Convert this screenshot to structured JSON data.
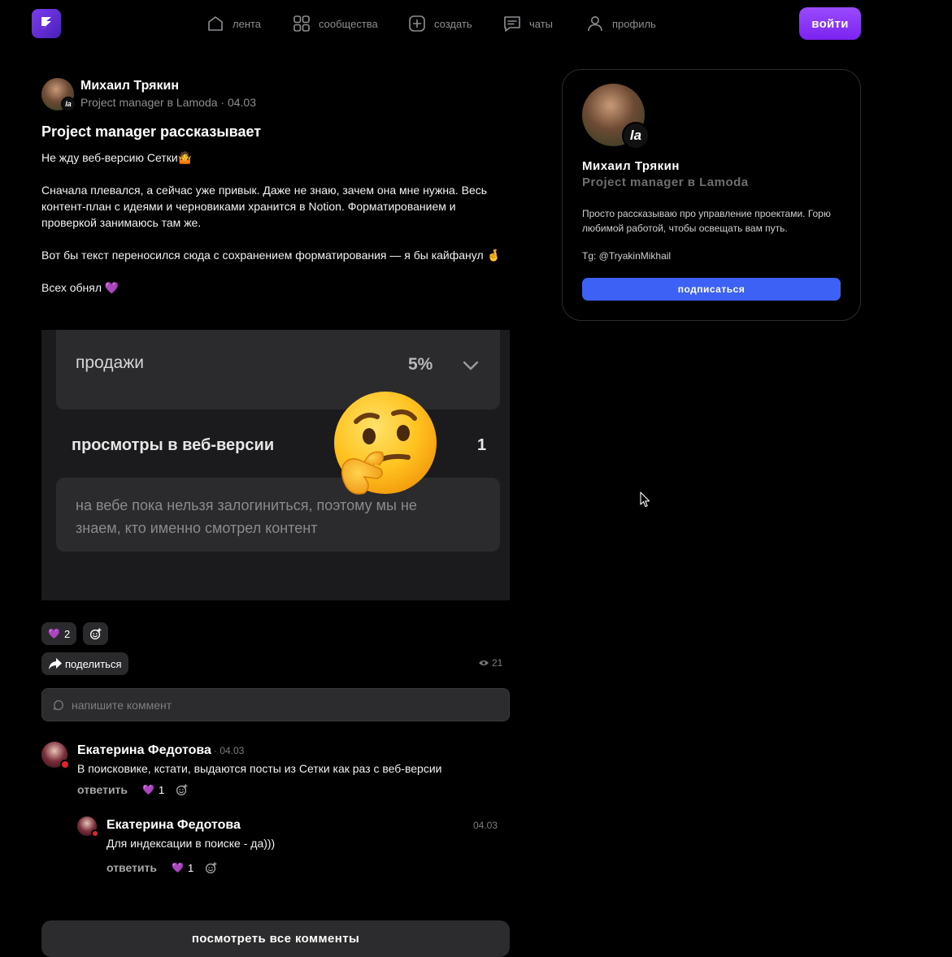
{
  "nav": {
    "items": [
      {
        "label": "лента",
        "icon": "home-icon"
      },
      {
        "label": "сообщества",
        "icon": "grid-icon"
      },
      {
        "label": "создать",
        "icon": "plus-square-icon"
      },
      {
        "label": "чаты",
        "icon": "chat-icon"
      },
      {
        "label": "профиль",
        "icon": "user-icon"
      }
    ],
    "login_label": "войти"
  },
  "post": {
    "author_name": "Михаил Трякин",
    "author_meta": "Project manager в Lamoda · 04.03",
    "avatar_badge": "la",
    "title": "Project manager рассказывает",
    "paragraphs": [
      "Не жду веб-версию Сетки🤷",
      "",
      "Сначала плевался, а сейчас уже привык. Даже не знаю, зачем она мне нужна. Весь контент-план с идеями и черновиками хранится в Notion. Форматированием и проверкой занимаюсь там же.",
      "",
      "Вот бы текст переносился сюда с сохранением форматирования — я бы кайфанул 🤞",
      "",
      "Всех обнял 💜"
    ],
    "image": {
      "sales_label": "продажи",
      "sales_pct": "5%",
      "views_label": "просмотры в веб-версии",
      "views_num": "1",
      "note": "на вебе пока нельзя залогиниться, поэтому мы не знаем, кто именно смотрел контент",
      "emoji": "thinking-face-emoji"
    },
    "reactions": {
      "heart_count": "2"
    },
    "share_label": "поделиться",
    "views": "21",
    "comment_placeholder": "напишите коммент"
  },
  "comments": [
    {
      "name": "Екатерина Федотова",
      "date": "· 04.03",
      "text": "В поисковике, кстати, выдаются посты из Сетки как раз с веб-версии",
      "reply_label": "ответить",
      "likes": "1"
    },
    {
      "name": "Екатерина Федотова",
      "date": "04.03",
      "text": "Для индексации в поиске - да)))",
      "reply_label": "ответить",
      "likes": "1"
    }
  ],
  "all_comments_label": "посмотреть все комменты",
  "profile": {
    "name": "Михаил Трякин",
    "role": "Project manager в Lamoda",
    "avatar_badge": "la",
    "bio": "Просто рассказываю про управление проектами. Горю любимой работой, чтобы освещать вам путь.",
    "tg": "Tg: @TryakinMikhail",
    "subscribe_label": "подписаться"
  },
  "colors": {
    "accent": "#7b22f0",
    "subscribe": "#3d61f5",
    "heart": "#a25bff"
  }
}
